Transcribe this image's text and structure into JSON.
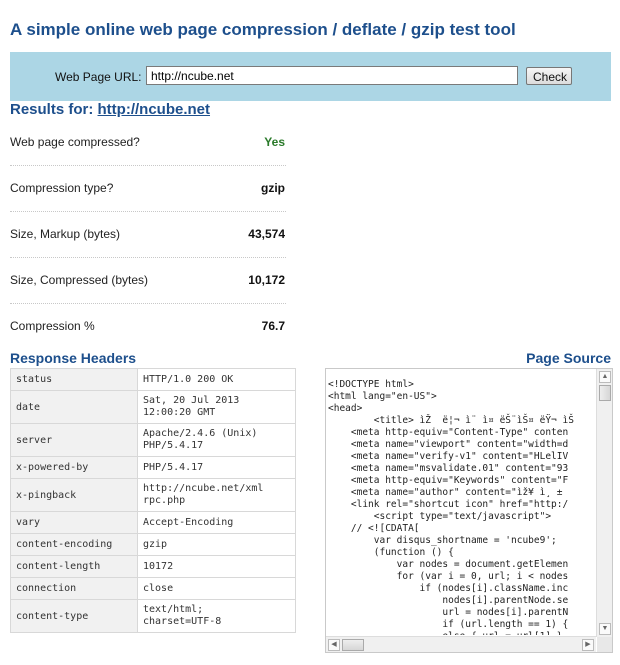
{
  "title": "A simple online web page compression / deflate / gzip test tool",
  "form": {
    "url_label": "Web Page URL:",
    "url_value": "http://ncube.net",
    "check_label": "Check"
  },
  "results": {
    "prefix": "Results for:",
    "url": "http://ncube.net",
    "metrics": [
      {
        "label": "Web page compressed?",
        "value": "Yes"
      },
      {
        "label": "Compression type?",
        "value": "gzip"
      },
      {
        "label": "Size, Markup (bytes)",
        "value": "43,574"
      },
      {
        "label": "Size, Compressed (bytes)",
        "value": "10,172"
      },
      {
        "label": "Compression %",
        "value": "76.7"
      }
    ]
  },
  "response_headers": {
    "title": "Response Headers",
    "rows": [
      {
        "key": "status",
        "value": "HTTP/1.0 200 OK"
      },
      {
        "key": "date",
        "value": "Sat, 20 Jul 2013\n12:00:20 GMT"
      },
      {
        "key": "server",
        "value": "Apache/2.4.6 (Unix)\nPHP/5.4.17"
      },
      {
        "key": "x-powered-by",
        "value": "PHP/5.4.17"
      },
      {
        "key": "x-pingback",
        "value": "http://ncube.net/xml\nrpc.php"
      },
      {
        "key": "vary",
        "value": "Accept-Encoding"
      },
      {
        "key": "content-encoding",
        "value": "gzip"
      },
      {
        "key": "content-length",
        "value": "10172"
      },
      {
        "key": "connection",
        "value": "close"
      },
      {
        "key": "content-type",
        "value": "text/html;\ncharset=UTF-8"
      }
    ]
  },
  "page_source": {
    "title": "Page Source",
    "text": "<!DOCTYPE html>\n<html lang=\"en-US\">\n<head>\n        <title> ìŽ  ë¦¬ ì¨ ì¤ ëŠ¨ìŠ¤ ëŸ¬ ìŠ\n    <meta http-equiv=\"Content-Type\" conten\n    <meta name=\"viewport\" content=\"width=d\n    <meta name=\"verify-v1\" content=\"HLelIV\n    <meta name=\"msvalidate.01\" content=\"93\n    <meta http-equiv=\"Keywords\" content=\"F\n    <meta name=\"author\" content=\"ìž¥ ì¸ ±\n    <link rel=\"shortcut icon\" href=\"http:/\n        <script type=\"text/javascript\">\n    // <![CDATA[\n        var disqus_shortname = 'ncube9';\n        (function () {\n            var nodes = document.getElemen\n            for (var i = 0, url; i < nodes\n                if (nodes[i].className.inc\n                    nodes[i].parentNode.se\n                    url = nodes[i].parentN\n                    if (url.length == 1) {\n                    else { url = url[1] }"
  }
}
